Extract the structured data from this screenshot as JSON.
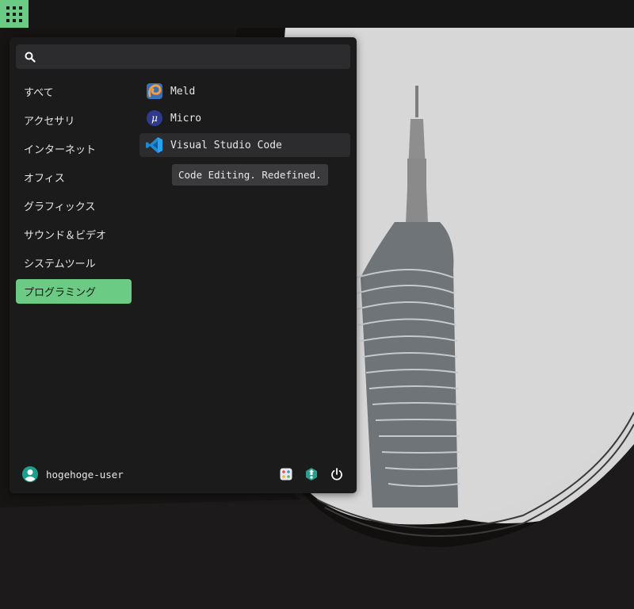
{
  "topbar": {
    "apps_icon": "apps-grid-icon"
  },
  "menu": {
    "search": {
      "placeholder": "",
      "value": ""
    },
    "categories": [
      {
        "label": "すべて"
      },
      {
        "label": "アクセサリ"
      },
      {
        "label": "インターネット"
      },
      {
        "label": "オフィス"
      },
      {
        "label": "グラフィックス"
      },
      {
        "label": "サウンド＆ビデオ"
      },
      {
        "label": "システムツール"
      },
      {
        "label": "プログラミング",
        "active": true
      }
    ],
    "apps": [
      {
        "label": "Meld",
        "icon": "meld-icon"
      },
      {
        "label": "Micro",
        "icon": "micro-icon"
      },
      {
        "label": "Visual Studio Code",
        "icon": "vscode-icon"
      }
    ],
    "tooltip": "Code Editing. Redefined.",
    "user": {
      "name": "hogehoge-user"
    },
    "actions": [
      "settings-icon",
      "software-store-icon",
      "power-icon"
    ]
  },
  "colors": {
    "accent": "#6bcb84",
    "panel": "#1b1b1c",
    "topbar": "#161616"
  }
}
